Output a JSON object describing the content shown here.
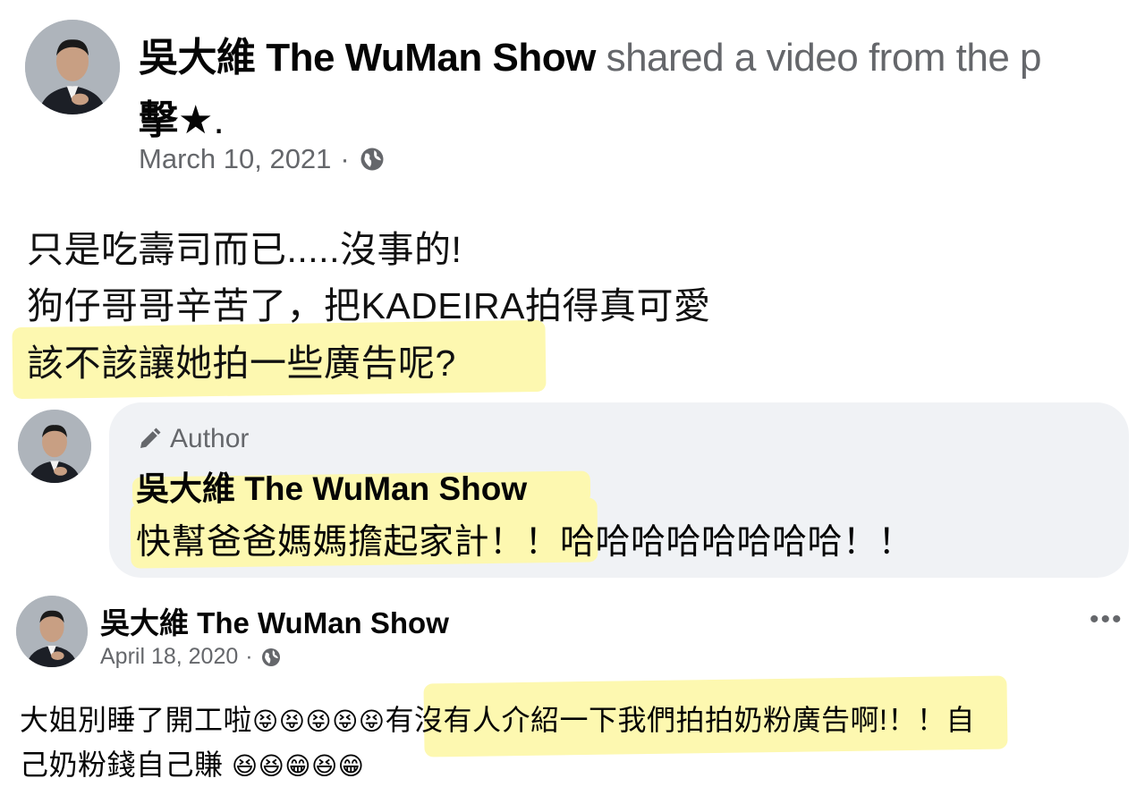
{
  "post1": {
    "author": "吳大維 The WuMan Show",
    "shared_text": "shared a video from the p",
    "page_name": "擊★",
    "page_name_suffix": ".",
    "date": "March 10, 2021",
    "date_sep": "·",
    "privacy_icon": "globe-icon",
    "lines": [
      "只是吃壽司而已.....沒事的!",
      "狗仔哥哥辛苦了，把KADEIRA拍得真可愛",
      "該不該讓她拍一些廣告呢?"
    ]
  },
  "comment": {
    "badge": "Author",
    "badge_icon": "pencil-icon",
    "author": "吳大維 The WuMan Show",
    "text": "快幫爸爸媽媽擔起家計！！哈哈哈哈哈哈哈哈！！"
  },
  "post2": {
    "author": "吳大維 The WuMan Show",
    "date": "April 18, 2020",
    "date_sep": "·",
    "more_label": "•••",
    "line1_a": "大姐別睡了開工啦",
    "line1_emoji": "😝😝😝😝😝",
    "line1_b": "有沒有人介紹一下我們拍拍奶粉廣告啊!",
    "line1_c": "！！自",
    "line2_a": "己奶粉錢自己賺 ",
    "line2_emoji": "😆😆😁😆😁"
  },
  "colors": {
    "highlight": "#fdf8b0",
    "secondary_text": "#65676b",
    "bubble_bg": "#f0f2f5"
  }
}
